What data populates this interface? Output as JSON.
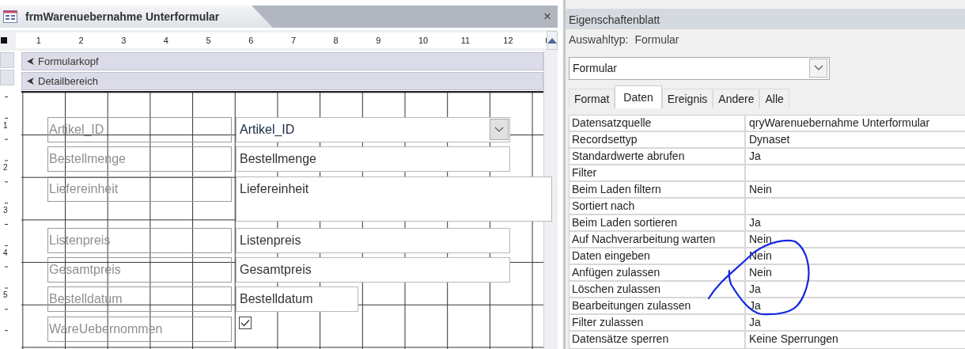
{
  "document_tab": {
    "title": "frmWarenuebernahme Unterformular",
    "close": "×"
  },
  "ruler": [
    "1",
    "2",
    "3",
    "4",
    "5",
    "6",
    "7",
    "8",
    "9",
    "10",
    "11",
    "12"
  ],
  "vertical_ruler": [
    "1",
    "2",
    "3",
    "4",
    "5"
  ],
  "sections": [
    {
      "label": "Formularkopf"
    },
    {
      "label": "Detailbereich"
    }
  ],
  "controls": [
    {
      "kind": "combo",
      "label": "Artikel_ID",
      "value": "Artikel_ID"
    },
    {
      "kind": "text",
      "label": "Bestellmenge",
      "value": "Bestellmenge"
    },
    {
      "kind": "memo",
      "label": "Liefereinheit",
      "value": "Liefereinheit"
    },
    {
      "kind": "text",
      "label": "Listenpreis",
      "value": "Listenpreis"
    },
    {
      "kind": "text",
      "label": "Gesamtpreis",
      "value": "Gesamtpreis"
    },
    {
      "kind": "short",
      "label": "Bestelldatum",
      "value": "Bestelldatum"
    },
    {
      "kind": "checkbox",
      "label": "WareUebernommen",
      "checked": true
    }
  ],
  "property_sheet": {
    "title": "Eigenschaftenblatt",
    "selection_type_label": "Auswahltyp:",
    "selection_type": "Formular",
    "object_dropdown": "Formular",
    "tabs": [
      {
        "label": "Format",
        "selected": false
      },
      {
        "label": "Daten",
        "selected": true
      },
      {
        "label": "Ereignis",
        "selected": false
      },
      {
        "label": "Andere",
        "selected": false
      },
      {
        "label": "Alle",
        "selected": false
      }
    ],
    "properties": [
      {
        "name": "Datensatzquelle",
        "value": "qryWarenuebernahme Unterformular"
      },
      {
        "name": "Recordsettyp",
        "value": "Dynaset"
      },
      {
        "name": "Standardwerte abrufen",
        "value": "Ja"
      },
      {
        "name": "Filter"
      },
      {
        "name": "Beim Laden filtern",
        "value": "Nein"
      },
      {
        "name": "Sortiert nach"
      },
      {
        "name": "Beim Laden sortieren",
        "value": "Ja"
      },
      {
        "name": "Auf Nachverarbeitung warten",
        "value": "Nein"
      },
      {
        "name": "Daten eingeben",
        "value": "Nein"
      },
      {
        "name": "Anfügen zulassen",
        "value": "Nein"
      },
      {
        "name": "Löschen zulassen",
        "value": "Ja"
      },
      {
        "name": "Bearbeitungen zulassen",
        "value": "Ja"
      },
      {
        "name": "Filter zulassen",
        "value": "Ja"
      },
      {
        "name": "Datensätze sperren",
        "value": "Keine Sperrungen"
      }
    ]
  }
}
